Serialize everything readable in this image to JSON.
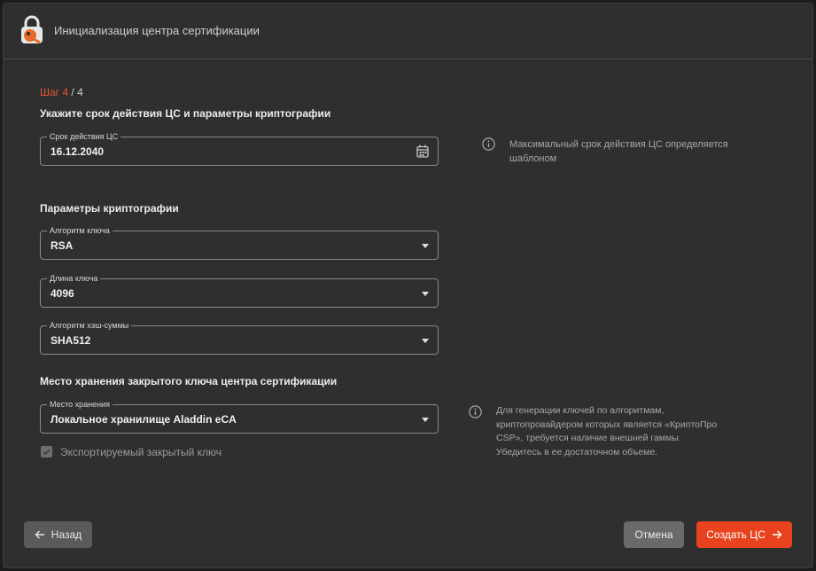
{
  "header": {
    "title": "Инициализация центра сертификации"
  },
  "step": {
    "current": "Шаг 4",
    "total": " / 4"
  },
  "section_validity": {
    "heading": "Укажите срок действия ЦС и параметры криптографии",
    "field": {
      "label": "Срок действия ЦС",
      "value": "16.12.2040"
    },
    "info": "Максимальный срок действия ЦС определяется шаблоном"
  },
  "section_crypto": {
    "heading": "Параметры криптографии",
    "fields": [
      {
        "label": "Алгоритм ключа",
        "value": "RSA"
      },
      {
        "label": "Длина ключа",
        "value": "4096"
      },
      {
        "label": "Алгоритм хэш-суммы",
        "value": "SHA512"
      }
    ]
  },
  "section_storage": {
    "heading": "Место хранения закрытого ключа центра сертификации",
    "field": {
      "label": "Место хранения",
      "value": "Локальное хранилище Aladdin eCA"
    },
    "checkbox": {
      "label": "Экспортируемый закрытый ключ",
      "checked": true,
      "disabled": true
    },
    "info": "Для генерации ключей по алгоритмам, криптопровайдером которых является «КриптоПро CSP», требуется наличие внешней гаммы. Убедитесь в ее достаточном объеме."
  },
  "footer": {
    "back_label": "Назад",
    "cancel_label": "Отмена",
    "create_label": "Создать ЦС"
  },
  "colors": {
    "accent": "#e8421e",
    "step_accent": "#e8542c",
    "background": "#2f2f2f"
  },
  "icons": [
    "app-logo-icon",
    "calendar-icon",
    "info-icon",
    "chevron-down-icon",
    "arrow-left-icon",
    "arrow-right-icon",
    "check-icon"
  ]
}
